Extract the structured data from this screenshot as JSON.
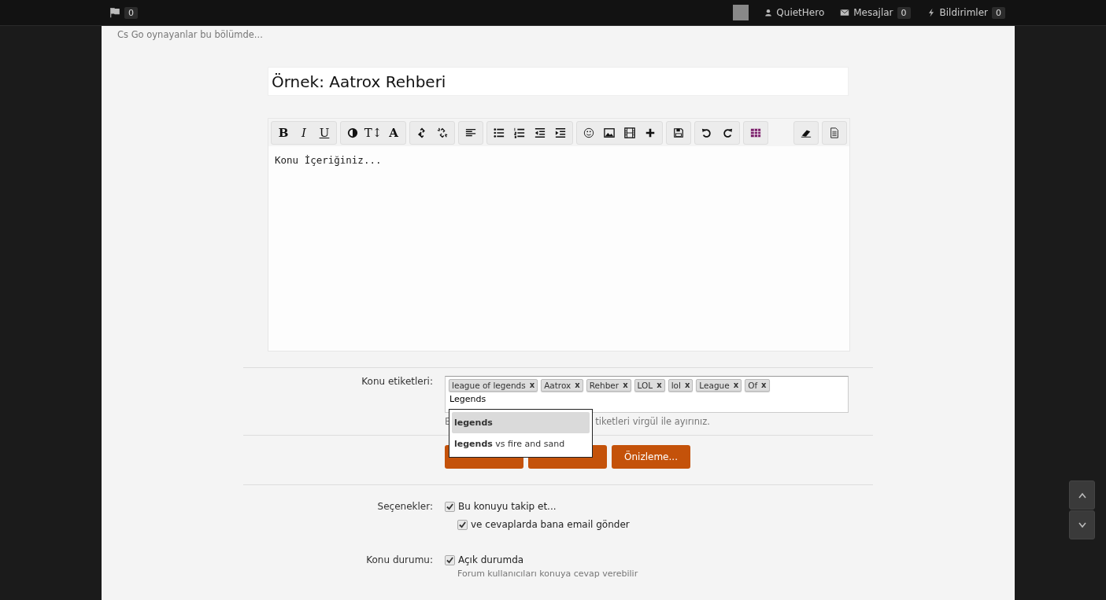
{
  "top_bar": {
    "flag_count": "0",
    "user": "QuietHero",
    "messages": {
      "label": "Mesajlar",
      "count": "0"
    },
    "alerts": {
      "label": "Bildirimler",
      "count": "0"
    }
  },
  "forum_description": "Cs Go oynayanlar bu bölümde...",
  "title_field": {
    "value": "Örnek: Aatrox Rehberi"
  },
  "toolbar": [
    [
      {
        "kind": "bold",
        "glyph": "B"
      },
      {
        "kind": "italic",
        "glyph": "I"
      },
      {
        "kind": "underline",
        "glyph": "U"
      }
    ],
    [
      {
        "kind": "contrast"
      },
      {
        "kind": "plain",
        "glyph": "T↕"
      },
      {
        "kind": "bold",
        "glyph": "A"
      }
    ],
    [
      {
        "kind": "link"
      },
      {
        "kind": "unlink"
      }
    ],
    [
      {
        "kind": "align"
      }
    ],
    [
      {
        "kind": "bullets"
      },
      {
        "kind": "numbers"
      },
      {
        "kind": "outdent"
      },
      {
        "kind": "indent"
      }
    ],
    [
      {
        "kind": "smiley"
      },
      {
        "kind": "image"
      },
      {
        "kind": "film"
      },
      {
        "kind": "plus"
      }
    ],
    [
      {
        "kind": "save"
      }
    ],
    [
      {
        "kind": "undo"
      },
      {
        "kind": "redo"
      }
    ],
    [
      {
        "kind": "table"
      }
    ],
    [
      {
        "kind": "spacer"
      }
    ],
    [
      {
        "kind": "eraser"
      }
    ],
    [
      {
        "kind": "source"
      }
    ]
  ],
  "editor": {
    "value": "Konu İçeriğiniz..."
  },
  "tags": {
    "label": "Konu etiketleri:",
    "items": [
      {
        "text": "league of legends",
        "remove": "x"
      },
      {
        "text": "Aatrox",
        "remove": "x"
      },
      {
        "text": "Rehber",
        "remove": "x"
      },
      {
        "text": "LOL",
        "remove": "x"
      },
      {
        "text": "lol",
        "remove": "x"
      },
      {
        "text": "League",
        "remove": "x"
      },
      {
        "text": "Of",
        "remove": "x"
      }
    ],
    "input": "Legends",
    "hint_start": "E",
    "hint_end": "tiketleri virgül ile ayırınız.",
    "suggestions": [
      {
        "text": "**legends**",
        "selected": true
      },
      {
        "text": "**legends** vs fire and sand",
        "selected": false
      }
    ]
  },
  "buttons": [
    {
      "kind": "hidden"
    },
    {
      "kind": "hidden"
    },
    {
      "kind": "labeled",
      "label": "Önizleme..."
    }
  ],
  "options": {
    "label": "Seçenekler:",
    "items": [
      {
        "text": "Bu konuyu takip et...",
        "checked": true,
        "nested": false
      },
      {
        "text": "ve cevaplarda bana email gönder",
        "checked": true,
        "nested": true
      }
    ]
  },
  "status": {
    "label": "Konu durumu:",
    "items": [
      {
        "text": "Açık durumda",
        "checked": true,
        "note": "Forum kullanıcıları konuya cevap verebilir"
      }
    ]
  }
}
